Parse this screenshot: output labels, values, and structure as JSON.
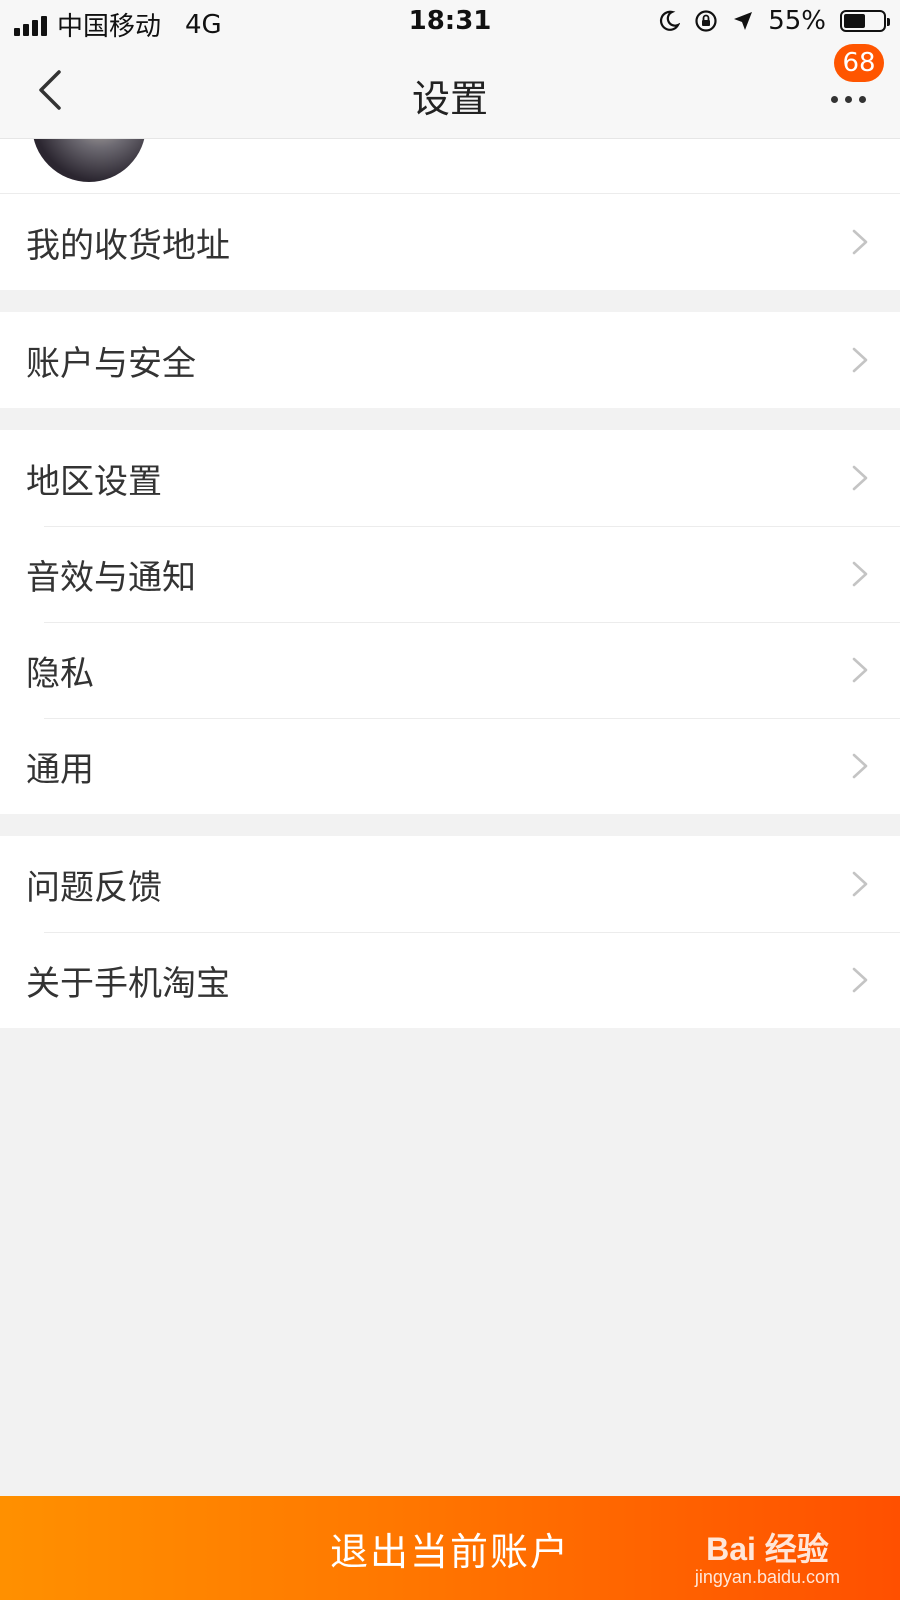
{
  "status_bar": {
    "carrier": "中国移动",
    "network": "4G",
    "time": "18:31",
    "battery_percent_label": "55%",
    "battery_level": 0.55
  },
  "nav": {
    "title": "设置",
    "badge_count": "68"
  },
  "groups": [
    {
      "items": [
        {
          "label": "我的收货地址"
        }
      ]
    },
    {
      "items": [
        {
          "label": "账户与安全"
        }
      ]
    },
    {
      "items": [
        {
          "label": "地区设置"
        },
        {
          "label": "音效与通知"
        },
        {
          "label": "隐私"
        },
        {
          "label": "通用"
        }
      ]
    },
    {
      "items": [
        {
          "label": "问题反馈"
        },
        {
          "label": "关于手机淘宝"
        }
      ]
    }
  ],
  "footer": {
    "logout_label": "退出当前账户"
  },
  "watermark": {
    "brand": "Bai 经验",
    "url": "jingyan.baidu.com"
  },
  "colors": {
    "accent": "#ff5500",
    "button_gradient_start": "#ff9000",
    "button_gradient_end": "#ff5000"
  }
}
